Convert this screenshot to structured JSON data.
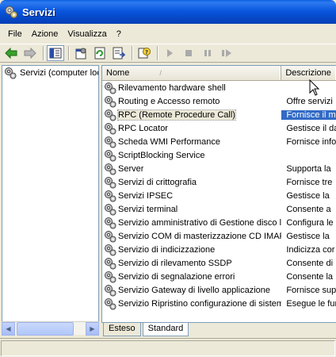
{
  "window": {
    "title": "Servizi"
  },
  "menu": [
    {
      "label": "File"
    },
    {
      "label": "Azione"
    },
    {
      "label": "Visualizza"
    },
    {
      "label": "?"
    }
  ],
  "toolbar": {
    "buttons": [
      "back-arrow",
      "forward-arrow",
      "show-hide-tree",
      "properties",
      "refresh",
      "export-list",
      "help",
      "play",
      "stop",
      "pause",
      "restart"
    ]
  },
  "tree": {
    "root_label": "Servizi (computer loc"
  },
  "list": {
    "columns": {
      "name": "Nome",
      "description": "Descrizione"
    },
    "rows": [
      {
        "name": "Rilevamento hardware shell",
        "description": ""
      },
      {
        "name": "Routing e Accesso remoto",
        "description": "Offre servizi"
      },
      {
        "name": "RPC (Remote Procedure Call)",
        "description": "Fornisce il m",
        "selected": true
      },
      {
        "name": "RPC Locator",
        "description": "Gestisce il da"
      },
      {
        "name": "Scheda WMI Performance",
        "description": "Fornisce info"
      },
      {
        "name": "ScriptBlocking Service",
        "description": ""
      },
      {
        "name": "Server",
        "description": "Supporta la"
      },
      {
        "name": "Servizi di crittografia",
        "description": "Fornisce tre"
      },
      {
        "name": "Servizi IPSEC",
        "description": "Gestisce la"
      },
      {
        "name": "Servizi terminal",
        "description": "Consente a"
      },
      {
        "name": "Servizio amministrativo di Gestione disco l...",
        "description": "Configura le"
      },
      {
        "name": "Servizio COM di masterizzazione CD IMAPI",
        "description": "Gestisce la"
      },
      {
        "name": "Servizio di indicizzazione",
        "description": "Indicizza cor"
      },
      {
        "name": "Servizio di rilevamento SSDP",
        "description": "Consente di"
      },
      {
        "name": "Servizio di segnalazione errori",
        "description": "Consente la"
      },
      {
        "name": "Servizio Gateway di livello applicazione",
        "description": "Fornisce sup"
      },
      {
        "name": "Servizio Ripristino configurazione di sistema",
        "description": "Esegue le fur"
      }
    ]
  },
  "tabs": [
    {
      "label": "Esteso",
      "active": false
    },
    {
      "label": "Standard",
      "active": true
    }
  ]
}
